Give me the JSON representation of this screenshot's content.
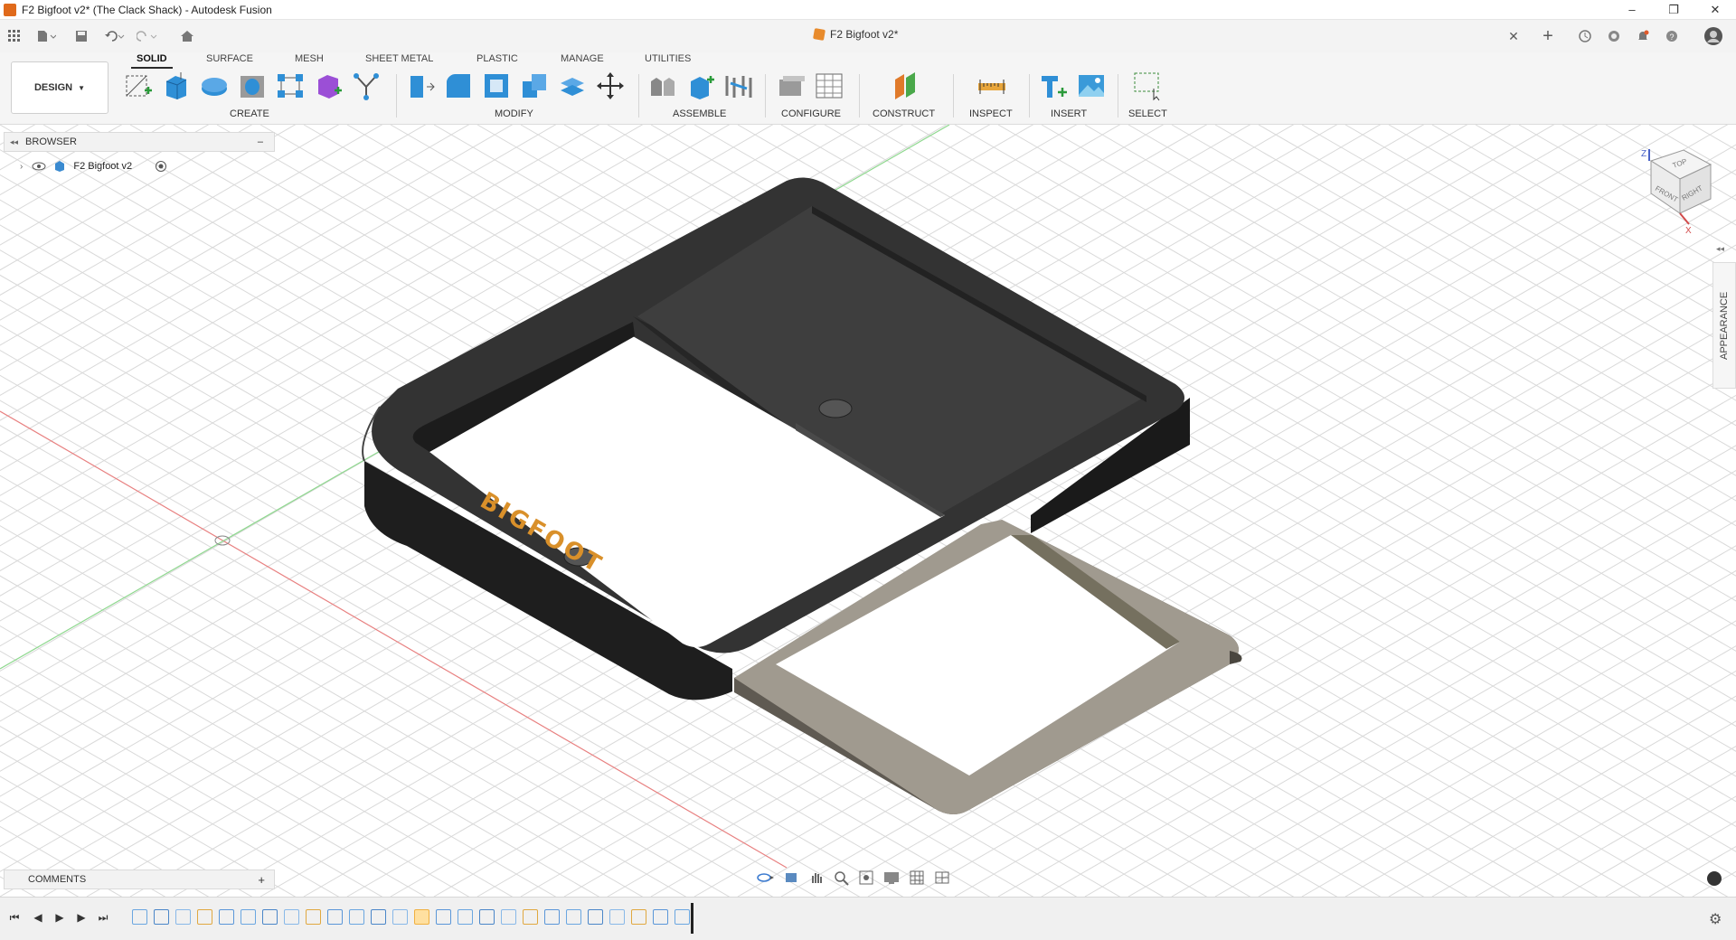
{
  "window": {
    "title": "F2 Bigfoot v2* (The Clack Shack) - Autodesk Fusion",
    "minimize": "–",
    "restore": "❐",
    "close": "✕"
  },
  "document_tab": {
    "label": "F2 Bigfoot v2*",
    "close": "✕"
  },
  "ribbon": {
    "tabs": [
      "SOLID",
      "SURFACE",
      "MESH",
      "SHEET METAL",
      "PLASTIC",
      "MANAGE",
      "UTILITIES"
    ],
    "active_tab": "SOLID",
    "workspace": "DESIGN",
    "groups": [
      "CREATE",
      "MODIFY",
      "ASSEMBLE",
      "CONFIGURE",
      "CONSTRUCT",
      "INSPECT",
      "INSERT",
      "SELECT"
    ]
  },
  "browser": {
    "title": "BROWSER",
    "collapse": "–",
    "root_item": "F2 Bigfoot v2"
  },
  "appearance_panel": {
    "label": "APPEARANCE"
  },
  "comments": {
    "label": "COMMENTS",
    "add": "+"
  },
  "model": {
    "text": "BIGFOOT"
  },
  "viewcube": {
    "top": "TOP",
    "front": "FRONT",
    "right": "RIGHT",
    "z": "Z",
    "x": "X"
  },
  "colors": {
    "ribbon_bg": "#f5f5f5",
    "model_dark": "#2d2d2d",
    "model_plate": "#6b665c",
    "logo_text": "#d9902a",
    "grid_line": "#d9d9d9",
    "axis_red": "#e06666",
    "axis_green": "#7fd07f"
  },
  "icons": [
    "grid-apps-icon",
    "file-icon",
    "save-icon",
    "undo-icon",
    "redo-icon",
    "home-icon",
    "plus-icon",
    "clock-icon",
    "online-icon",
    "bell-icon",
    "help-icon",
    "avatar-icon"
  ]
}
